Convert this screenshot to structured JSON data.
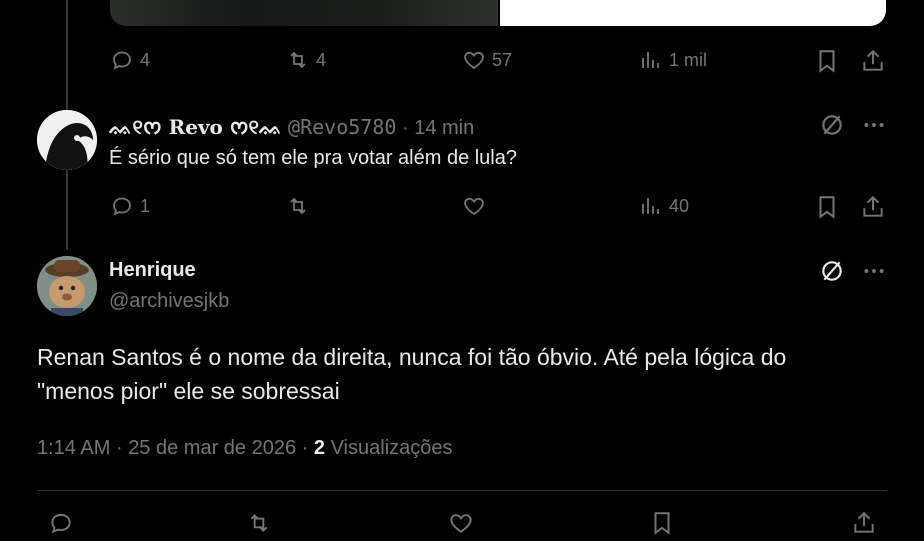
{
  "top_tweet": {
    "replies": "4",
    "retweets": "4",
    "likes": "57",
    "views": "1 mil"
  },
  "reply": {
    "display_name": "ᨐ୧ᰔ Revo ᰔ୧ᨐ",
    "handle": "@Revo5780",
    "time": "14 min",
    "text": "É sério que só tem ele pra votar além de lula?",
    "replies": "1",
    "views": "40"
  },
  "main_tweet": {
    "display_name": "Henrique",
    "handle": "@archivesjkb",
    "text_line1": "Renan Santos é o nome da direita, nunca foi tão óbvio. Até pela lógica do",
    "text_line2": "\"menos pior\" ele se sobressai",
    "time": "1:14 AM",
    "date": "25 de mar de 2026",
    "views_count": "2",
    "views_label": "Visualizações"
  },
  "icons": {
    "reply": "reply-icon",
    "retweet": "retweet-icon",
    "like": "heart-icon",
    "views": "views-icon",
    "bookmark": "bookmark-icon",
    "share": "share-icon",
    "grok": "grok-icon",
    "more": "more-icon"
  }
}
